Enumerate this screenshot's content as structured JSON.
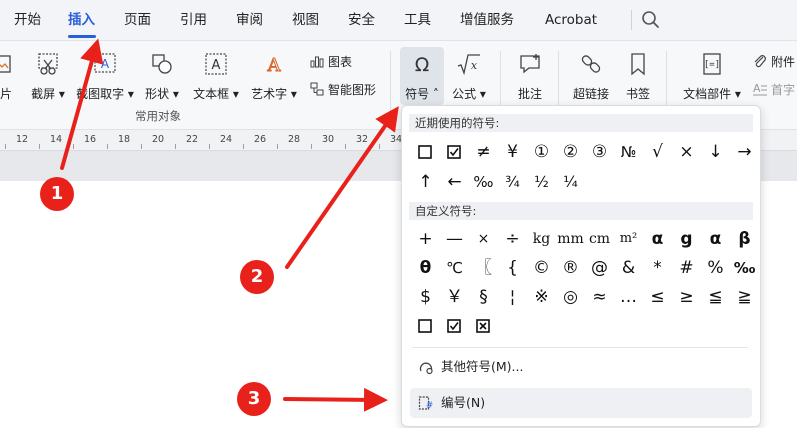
{
  "menubar": {
    "tabs": [
      "开始",
      "插入",
      "页面",
      "引用",
      "审阅",
      "视图",
      "安全",
      "工具",
      "增值服务",
      "Acrobat"
    ],
    "active_tab": "插入",
    "search_icon": "search-icon"
  },
  "ribbon": {
    "left_cut_label": "片",
    "screenshot_label": "截屏",
    "screen_grab_label": "截图取字",
    "shapes_label": "形状",
    "textbox_label": "文本框",
    "wordart_label": "艺术字",
    "chart_label": "图表",
    "smartart_label": "智能图形",
    "group_label": "常用对象",
    "symbol_label": "符号",
    "formula_label": "公式",
    "comment_label": "批注",
    "hyperlink_label": "超链接",
    "bookmark_label": "书签",
    "doc_parts_label": "文档部件",
    "attachment_label": "附件",
    "dropcap_label": "首字"
  },
  "ruler": {
    "numbers": [
      "12",
      "14",
      "16",
      "18",
      "20",
      "22",
      "24",
      "26",
      "28",
      "30",
      "32",
      "34"
    ]
  },
  "symbol_panel": {
    "recent_header": "近期使用的符号:",
    "recent_symbols": [
      "☐",
      "☑",
      "≠",
      "¥",
      "①",
      "②",
      "③",
      "№",
      "√",
      "×",
      "↓",
      "→",
      "↑",
      "←",
      "‰",
      "¾",
      "½",
      "¼"
    ],
    "custom_header": "自定义符号:",
    "custom_symbols": [
      "+",
      "—",
      "×",
      "÷",
      "kg",
      "mm",
      "cm",
      "m²",
      "α",
      "g",
      "α",
      "β",
      "θ",
      "℃",
      "〖",
      "{",
      "©",
      "®",
      "@",
      "&",
      "*",
      "#",
      "%",
      "‰",
      "$",
      "￥",
      "§",
      "¦",
      "※",
      "◎",
      "≈",
      "…",
      "≤",
      "≥",
      "≦",
      "≧",
      "☐",
      "☑",
      "☒"
    ],
    "more_symbols_label": "其他符号(M)...",
    "numbering_label": "编号(N)"
  },
  "annotations": {
    "badge1": "1",
    "badge2": "2",
    "badge3": "3",
    "arrow_color": "#e8221b"
  },
  "colors": {
    "accent": "#2b5fd9",
    "annotation": "#e8221b"
  }
}
